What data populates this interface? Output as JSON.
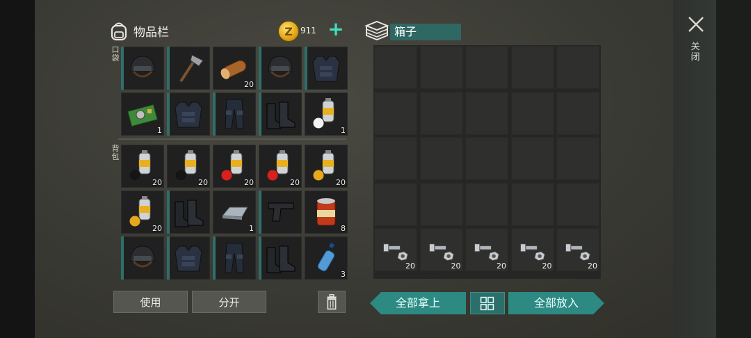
{
  "inventory": {
    "title": "物品栏",
    "coins": "911",
    "pocket_label": "口袋",
    "backpack_label": "背包",
    "pocket_items": [
      {
        "icon": "helmet-icon",
        "qty": "",
        "equipped": true
      },
      {
        "icon": "hatchet-icon",
        "qty": "",
        "equipped": true
      },
      {
        "icon": "log-icon",
        "qty": "20",
        "equipped": false
      },
      {
        "icon": "helmet-icon",
        "qty": "",
        "equipped": true
      },
      {
        "icon": "armor-vest-icon",
        "qty": "",
        "equipped": true
      },
      {
        "icon": "circuit-board-icon",
        "qty": "1",
        "equipped": false
      },
      {
        "icon": "armor-vest-icon",
        "qty": "",
        "equipped": true
      },
      {
        "icon": "armor-pants-icon",
        "qty": "",
        "equipped": true
      },
      {
        "icon": "boots-icon",
        "qty": "",
        "equipped": true
      },
      {
        "icon": "spray-paint-white-icon",
        "qty": "1",
        "equipped": false
      }
    ],
    "backpack_items": [
      {
        "icon": "spray-paint-black-icon",
        "qty": "20",
        "equipped": false
      },
      {
        "icon": "spray-paint-black-icon",
        "qty": "20",
        "equipped": false
      },
      {
        "icon": "spray-paint-red-icon",
        "qty": "20",
        "equipped": false
      },
      {
        "icon": "spray-paint-red-icon",
        "qty": "20",
        "equipped": false
      },
      {
        "icon": "spray-paint-yellow-icon",
        "qty": "20",
        "equipped": false
      },
      {
        "icon": "spray-paint-yellow-icon",
        "qty": "20",
        "equipped": false
      },
      {
        "icon": "boots-icon",
        "qty": "",
        "equipped": true
      },
      {
        "icon": "metal-ingot-icon",
        "qty": "1",
        "equipped": false
      },
      {
        "icon": "pistol-icon",
        "qty": "",
        "equipped": true
      },
      {
        "icon": "canned-food-icon",
        "qty": "8",
        "equipped": false
      },
      {
        "icon": "helmet-icon",
        "qty": "",
        "equipped": true
      },
      {
        "icon": "armor-vest-icon",
        "qty": "",
        "equipped": true
      },
      {
        "icon": "armor-pants-icon",
        "qty": "",
        "equipped": true
      },
      {
        "icon": "boots-icon",
        "qty": "",
        "equipped": true
      },
      {
        "icon": "water-bottle-icon",
        "qty": "3",
        "equipped": false
      }
    ],
    "use_label": "使用",
    "split_label": "分开"
  },
  "box": {
    "title": "箱子",
    "items": [
      {
        "slot": 20,
        "icon": "bolt-nut-icon",
        "qty": "20"
      },
      {
        "slot": 21,
        "icon": "bolt-nut-icon",
        "qty": "20"
      },
      {
        "slot": 22,
        "icon": "bolt-nut-icon",
        "qty": "20"
      },
      {
        "slot": 23,
        "icon": "bolt-nut-icon",
        "qty": "20"
      },
      {
        "slot": 24,
        "icon": "bolt-nut-icon",
        "qty": "20"
      }
    ],
    "take_all_label": "全部拿上",
    "put_all_label": "全部放入"
  },
  "close_label": "关闭",
  "colors": {
    "accent": "#2c8a83",
    "coin": "#e0a410",
    "plus": "#3ee0c0"
  }
}
